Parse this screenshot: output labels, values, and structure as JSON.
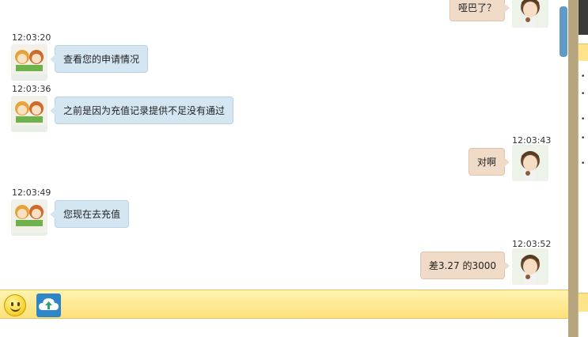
{
  "messages": [
    {
      "side": "out",
      "time": "",
      "text": "哑巴了？",
      "avatar": "boy-avatar"
    },
    {
      "side": "in",
      "time": "12:03:20",
      "text": "查看您的申请情况",
      "avatar": "agent-avatar"
    },
    {
      "side": "in",
      "time": "12:03:36",
      "text": "之前是因为充值记录提供不足没有通过",
      "avatar": "agent-avatar"
    },
    {
      "side": "out",
      "time": "12:03:43",
      "text": "对啊",
      "avatar": "boy-avatar"
    },
    {
      "side": "in",
      "time": "12:03:49",
      "text": "您现在去充值",
      "avatar": "agent-avatar"
    },
    {
      "side": "out",
      "time": "12:03:52",
      "text": "差3.27 的3000",
      "avatar": "boy-avatar"
    }
  ],
  "toolbar": {
    "emoji_icon": "smiley-icon",
    "upload_icon": "cloud-upload-icon"
  },
  "colors": {
    "incoming_bubble": "#d3e6f1",
    "outgoing_bubble": "#efdbc7",
    "toolbar": "#fde07a",
    "scrollbar_thumb": "#5f9bc5",
    "upload_button": "#2f86c7"
  }
}
